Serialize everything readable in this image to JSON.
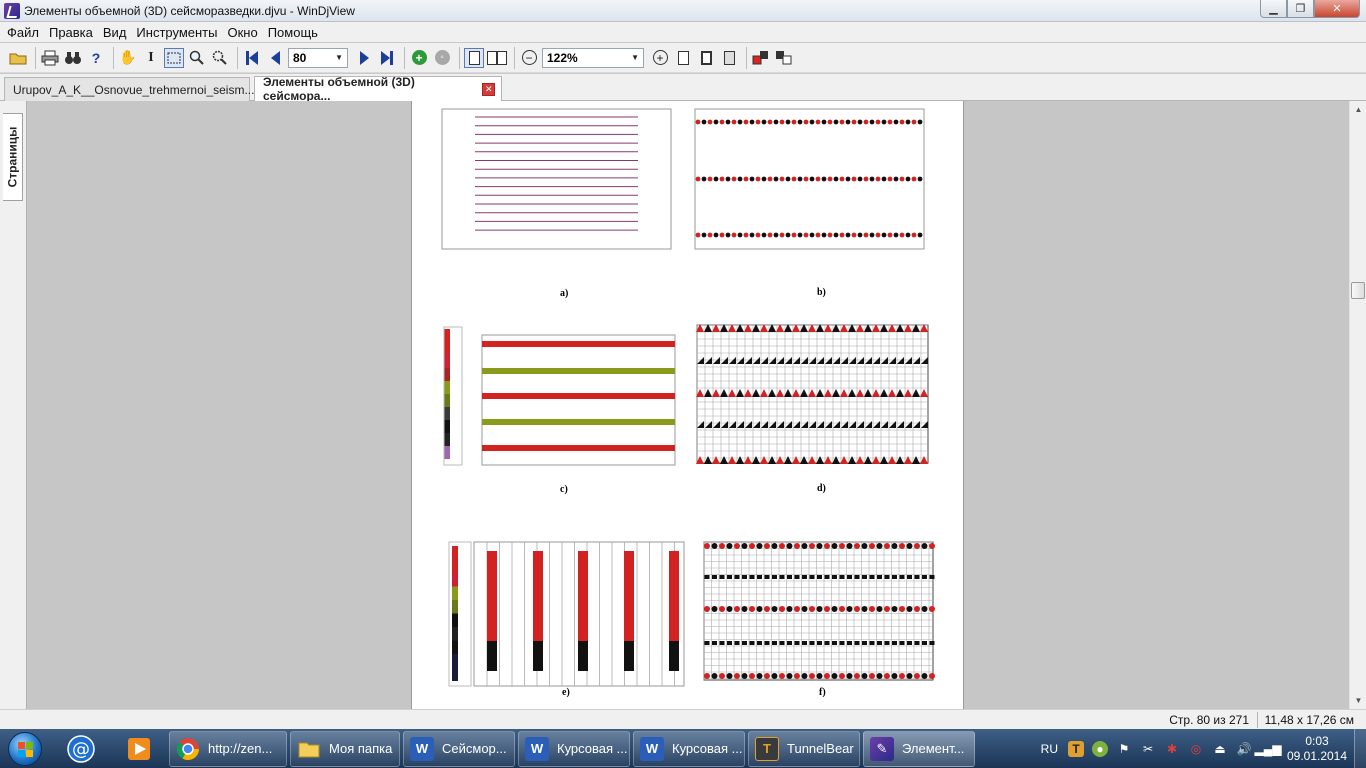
{
  "window": {
    "title": "Элементы объемной (3D) сейсморазведки.djvu - WinDjView"
  },
  "menu": {
    "items": [
      "Файл",
      "Правка",
      "Вид",
      "Инструменты",
      "Окно",
      "Помощь"
    ]
  },
  "toolbar": {
    "page_value": "80",
    "zoom_value": "122%"
  },
  "tabs": [
    {
      "label": "Urupov_A_K__Osnovue_trehmernoi_seism..."
    },
    {
      "label": "Элементы объемной (3D) сейсмора..."
    }
  ],
  "sidebar": {
    "pages_tab": "Страницы"
  },
  "page_labels": [
    "a)",
    "b)",
    "c)",
    "d)",
    "e)",
    "f)"
  ],
  "statusbar": {
    "page_info": "Стр. 80 из 271",
    "page_size": "11,48 x 17,26 см"
  },
  "taskbar": {
    "items": [
      {
        "label": "http://zen..."
      },
      {
        "label": "Моя папка"
      },
      {
        "label": "Сейсмор..."
      },
      {
        "label": "Курсовая ..."
      },
      {
        "label": "Курсовая ..."
      },
      {
        "label": "TunnelBear"
      },
      {
        "label": "Элемент..."
      }
    ],
    "lang": "RU",
    "time": "0:03",
    "date": "09.01.2014"
  },
  "colors": {
    "red": "#d22222",
    "black": "#111111",
    "olive": "#8a9a1a",
    "purple_line": "#8a3a6a"
  }
}
